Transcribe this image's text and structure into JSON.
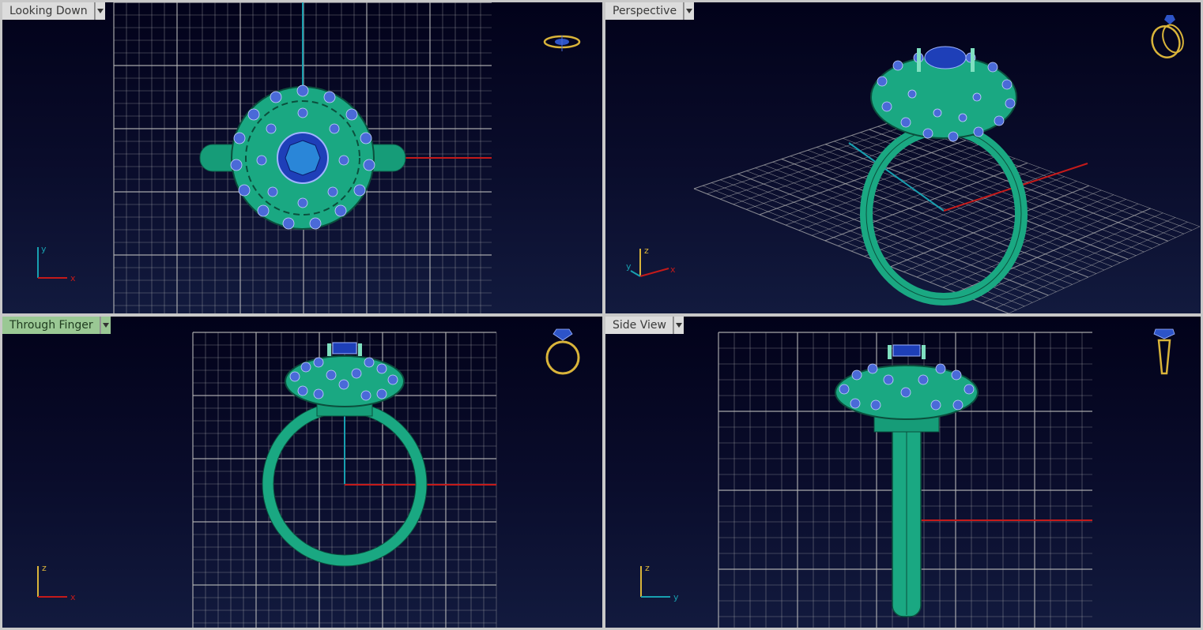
{
  "viewports": [
    {
      "id": "top",
      "title": "Looking Down",
      "active": false,
      "axes": {
        "v": "y",
        "h": "x"
      }
    },
    {
      "id": "perspective",
      "title": "Perspective",
      "active": false,
      "axes": {
        "v": "z",
        "h": "x",
        "d": "y"
      }
    },
    {
      "id": "front",
      "title": "Through Finger",
      "active": true,
      "axes": {
        "v": "z",
        "h": "x"
      }
    },
    {
      "id": "side",
      "title": "Side View",
      "active": false,
      "axes": {
        "v": "z",
        "h": "y"
      }
    }
  ],
  "colors": {
    "background": "#0a0d2c",
    "grid": "#b8b8b8",
    "metal": "#1fae86",
    "gem": "#1e3fb8",
    "accent": "#d9b43a",
    "x_axis": "#c41a1a",
    "y_axis": "#18a0b0",
    "z_axis": "#d9b43a"
  },
  "icons": {
    "top": "ring-top-view-icon",
    "perspective": "ring-perspective-icon",
    "front": "ring-front-view-icon",
    "side": "ring-side-view-icon"
  }
}
